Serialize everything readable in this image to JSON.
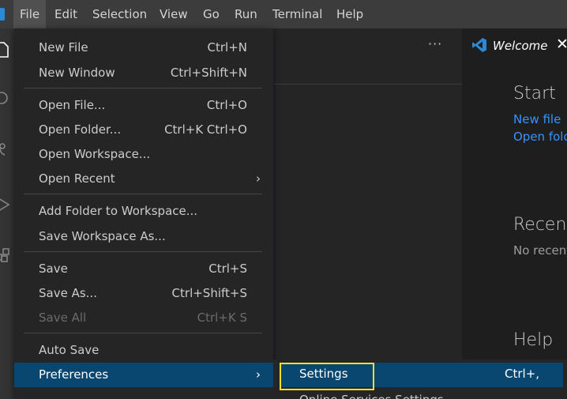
{
  "menubar": {
    "items": [
      {
        "label": "File"
      },
      {
        "label": "Edit"
      },
      {
        "label": "Selection"
      },
      {
        "label": "View"
      },
      {
        "label": "Go"
      },
      {
        "label": "Run"
      },
      {
        "label": "Terminal"
      },
      {
        "label": "Help"
      }
    ],
    "active": "File"
  },
  "sidebar": {
    "more_label": "···"
  },
  "editor": {
    "tab": {
      "label": "Welcome",
      "close": "✕"
    },
    "start_heading": "Start",
    "new_file_link": "New file",
    "open_folder_link": "Open fold",
    "recent_heading": "Recent",
    "no_recent_text": "No recent",
    "help_heading": "Help"
  },
  "file_menu": {
    "items": [
      {
        "label": "New File",
        "shortcut": "Ctrl+N"
      },
      {
        "label": "New Window",
        "shortcut": "Ctrl+Shift+N"
      },
      {
        "label": "Open File...",
        "shortcut": "Ctrl+O"
      },
      {
        "label": "Open Folder...",
        "shortcut": "Ctrl+K Ctrl+O"
      },
      {
        "label": "Open Workspace...",
        "shortcut": ""
      },
      {
        "label": "Open Recent",
        "shortcut": "",
        "submenu": true
      },
      {
        "label": "Add Folder to Workspace...",
        "shortcut": ""
      },
      {
        "label": "Save Workspace As...",
        "shortcut": ""
      },
      {
        "label": "Save",
        "shortcut": "Ctrl+S"
      },
      {
        "label": "Save As...",
        "shortcut": "Ctrl+Shift+S"
      },
      {
        "label": "Save All",
        "shortcut": "Ctrl+K S",
        "disabled": true
      },
      {
        "label": "Auto Save",
        "shortcut": ""
      },
      {
        "label": "Preferences",
        "shortcut": "",
        "submenu": true,
        "selected": true
      }
    ],
    "submenu_arrow": "›"
  },
  "preferences_submenu": {
    "items": [
      {
        "label": "Settings",
        "shortcut": "Ctrl+,",
        "selected": true
      },
      {
        "label": "Online Services Settings",
        "shortcut": ""
      }
    ]
  },
  "colors": {
    "menubar": "#3c3c3c",
    "menu_bg": "#252526",
    "selection": "#094771",
    "link": "#3794ff",
    "highlight_box": "#f2e21f"
  }
}
